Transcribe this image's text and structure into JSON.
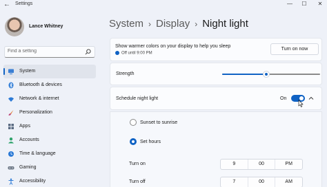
{
  "window": {
    "title": "Settings",
    "back_glyph": "←",
    "minimize_glyph": "—",
    "maximize_glyph": "☐",
    "close_glyph": "✕"
  },
  "user": {
    "name": "Lance Whitney"
  },
  "search": {
    "placeholder": "Find a setting"
  },
  "sidebar": {
    "items": [
      {
        "label": "System",
        "icon": "monitor-icon",
        "selected": true
      },
      {
        "label": "Bluetooth & devices",
        "icon": "bluetooth-icon"
      },
      {
        "label": "Network & internet",
        "icon": "wifi-icon"
      },
      {
        "label": "Personalization",
        "icon": "brush-icon"
      },
      {
        "label": "Apps",
        "icon": "apps-icon"
      },
      {
        "label": "Accounts",
        "icon": "person-icon"
      },
      {
        "label": "Time & language",
        "icon": "globe-clock-icon"
      },
      {
        "label": "Gaming",
        "icon": "gamepad-icon"
      },
      {
        "label": "Accessibility",
        "icon": "accessibility-icon"
      }
    ]
  },
  "breadcrumb": {
    "items": [
      "System",
      "Display"
    ],
    "separator": "›",
    "current": "Night light"
  },
  "night_light": {
    "description": "Show warmer colors on your display to help you sleep",
    "status": "Off until 9:00 PM",
    "turn_on_label": "Turn on now"
  },
  "strength": {
    "label": "Strength",
    "value_fraction": 0.45
  },
  "schedule": {
    "label": "Schedule night light",
    "toggle_state": "On",
    "toggle_on": true,
    "options": [
      {
        "label": "Sunset to sunrise",
        "checked": false
      },
      {
        "label": "Set hours",
        "checked": true
      }
    ],
    "turn_on": {
      "label": "Turn on",
      "hour": "9",
      "minute": "00",
      "period": "PM"
    },
    "turn_off": {
      "label": "Turn off",
      "hour": "7",
      "minute": "00",
      "period": "AM"
    }
  },
  "colors": {
    "accent": "#0f62c4",
    "background": "#eef1f8",
    "card": "#fbfcfe"
  }
}
